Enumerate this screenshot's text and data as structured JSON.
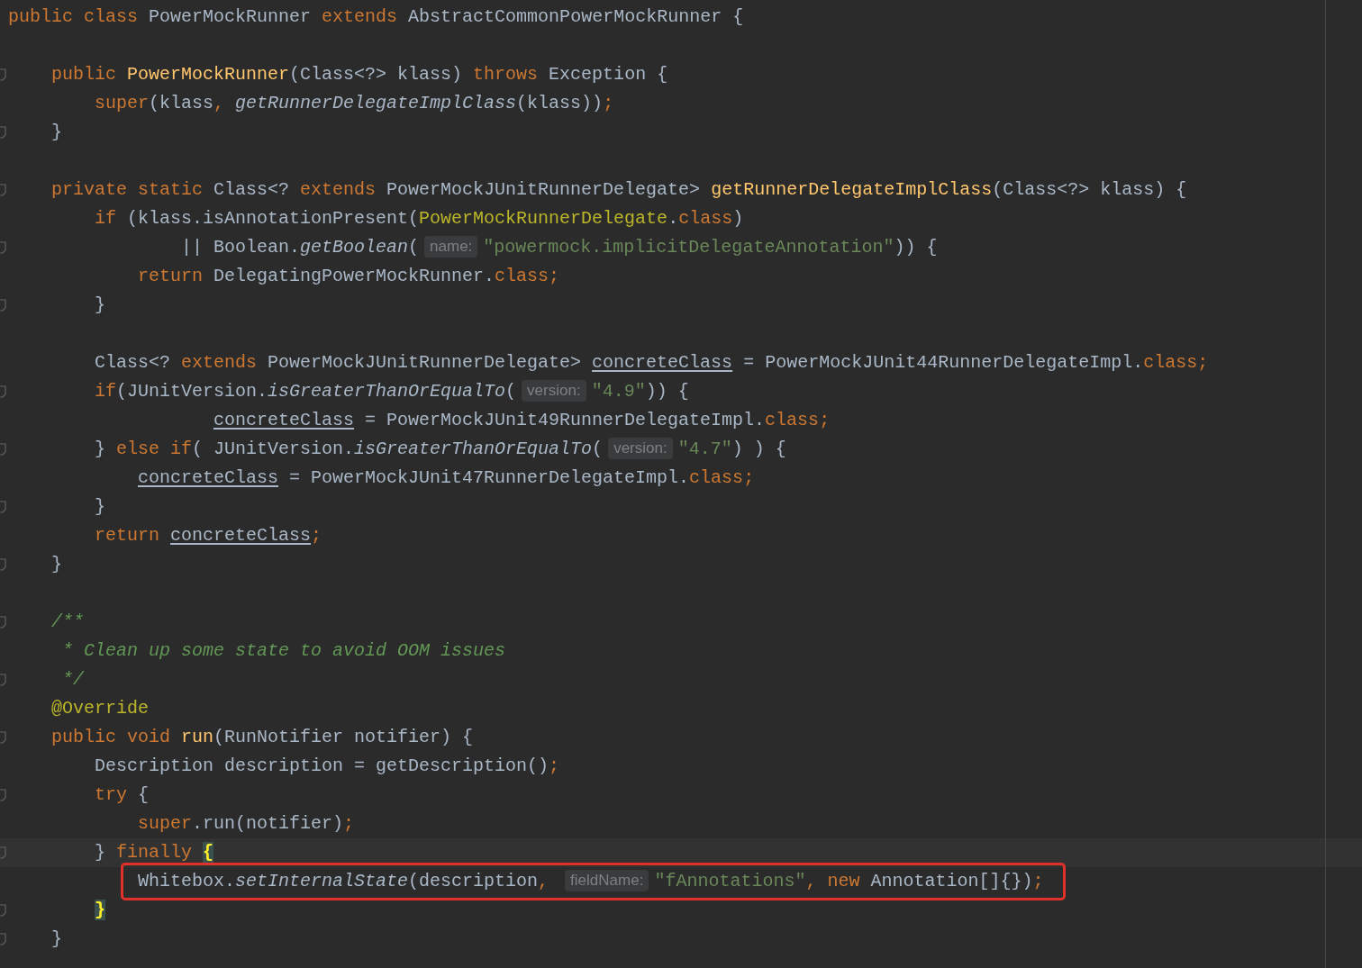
{
  "editor": {
    "lines": [
      {
        "kind": "code",
        "fold": false,
        "current": false,
        "boxed": false,
        "tokens": [
          {
            "kind": "kw",
            "text": "public class"
          },
          {
            "kind": "plain",
            "text": " PowerMockRunner "
          },
          {
            "kind": "kw",
            "text": "extends"
          },
          {
            "kind": "plain",
            "text": " AbstractCommonPowerMockRunner {"
          }
        ]
      },
      {
        "kind": "blank"
      },
      {
        "kind": "code",
        "fold": true,
        "current": false,
        "boxed": false,
        "tokens": [
          {
            "kind": "kw",
            "text": "    public "
          },
          {
            "kind": "decl",
            "text": "PowerMockRunner"
          },
          {
            "kind": "plain",
            "text": "(Class<?> klass) "
          },
          {
            "kind": "kw",
            "text": "throws"
          },
          {
            "kind": "plain",
            "text": " Exception {"
          }
        ]
      },
      {
        "kind": "code",
        "fold": false,
        "current": false,
        "boxed": false,
        "tokens": [
          {
            "kind": "kw",
            "text": "        super"
          },
          {
            "kind": "plain",
            "text": "(klass"
          },
          {
            "kind": "punct",
            "text": ", "
          },
          {
            "kind": "call",
            "text": "getRunnerDelegateImplClass"
          },
          {
            "kind": "plain",
            "text": "(klass))"
          },
          {
            "kind": "punct",
            "text": ";"
          }
        ]
      },
      {
        "kind": "code",
        "fold": true,
        "current": false,
        "boxed": false,
        "tokens": [
          {
            "kind": "plain",
            "text": "    }"
          }
        ]
      },
      {
        "kind": "blank"
      },
      {
        "kind": "code",
        "fold": true,
        "current": false,
        "boxed": false,
        "tokens": [
          {
            "kind": "kw",
            "text": "    private static "
          },
          {
            "kind": "plain",
            "text": "Class<? "
          },
          {
            "kind": "kw",
            "text": "extends"
          },
          {
            "kind": "plain",
            "text": " PowerMockJUnitRunnerDelegate> "
          },
          {
            "kind": "decl",
            "text": "getRunnerDelegateImplClass"
          },
          {
            "kind": "plain",
            "text": "(Class<?> klass) {"
          }
        ]
      },
      {
        "kind": "code",
        "fold": false,
        "current": false,
        "boxed": false,
        "tokens": [
          {
            "kind": "kw",
            "text": "        if"
          },
          {
            "kind": "plain",
            "text": " (klass.isAnnotationPresent("
          },
          {
            "kind": "annot",
            "text": "PowerMockRunnerDelegate"
          },
          {
            "kind": "plain",
            "text": "."
          },
          {
            "kind": "kw",
            "text": "class"
          },
          {
            "kind": "plain",
            "text": ")"
          }
        ]
      },
      {
        "kind": "code",
        "fold": true,
        "current": false,
        "boxed": false,
        "tokens": [
          {
            "kind": "plain",
            "text": "                || Boolean."
          },
          {
            "kind": "call",
            "text": "getBoolean"
          },
          {
            "kind": "plain",
            "text": "("
          },
          {
            "kind": "hint",
            "text": "name:"
          },
          {
            "kind": "str",
            "text": "\"powermock.implicitDelegateAnnotation\""
          },
          {
            "kind": "plain",
            "text": ")) {"
          }
        ]
      },
      {
        "kind": "code",
        "fold": false,
        "current": false,
        "boxed": false,
        "tokens": [
          {
            "kind": "kw",
            "text": "            return"
          },
          {
            "kind": "plain",
            "text": " DelegatingPowerMockRunner."
          },
          {
            "kind": "kw",
            "text": "class"
          },
          {
            "kind": "punct",
            "text": ";"
          }
        ]
      },
      {
        "kind": "code",
        "fold": true,
        "current": false,
        "boxed": false,
        "tokens": [
          {
            "kind": "plain",
            "text": "        }"
          }
        ]
      },
      {
        "kind": "blank"
      },
      {
        "kind": "code",
        "fold": false,
        "current": false,
        "boxed": false,
        "tokens": [
          {
            "kind": "plain",
            "text": "        Class<? "
          },
          {
            "kind": "kw",
            "text": "extends"
          },
          {
            "kind": "plain",
            "text": " PowerMockJUnitRunnerDelegate> "
          },
          {
            "kind": "field",
            "text": "concreteClass"
          },
          {
            "kind": "plain",
            "text": " = PowerMockJUnit44RunnerDelegateImpl."
          },
          {
            "kind": "kw",
            "text": "class"
          },
          {
            "kind": "punct",
            "text": ";"
          }
        ]
      },
      {
        "kind": "code",
        "fold": true,
        "current": false,
        "boxed": false,
        "tokens": [
          {
            "kind": "kw",
            "text": "        if"
          },
          {
            "kind": "plain",
            "text": "(JUnitVersion."
          },
          {
            "kind": "call",
            "text": "isGreaterThanOrEqualTo"
          },
          {
            "kind": "plain",
            "text": "("
          },
          {
            "kind": "hint",
            "text": "version:"
          },
          {
            "kind": "str",
            "text": "\"4.9\""
          },
          {
            "kind": "plain",
            "text": ")) {"
          }
        ]
      },
      {
        "kind": "code",
        "fold": false,
        "current": false,
        "boxed": false,
        "tokens": [
          {
            "kind": "field",
            "text": "                   concreteClass"
          },
          {
            "kind": "plain",
            "text": " = PowerMockJUnit49RunnerDelegateImpl."
          },
          {
            "kind": "kw",
            "text": "class"
          },
          {
            "kind": "punct",
            "text": ";"
          }
        ]
      },
      {
        "kind": "code",
        "fold": true,
        "current": false,
        "boxed": false,
        "tokens": [
          {
            "kind": "plain",
            "text": "        } "
          },
          {
            "kind": "kw",
            "text": "else if"
          },
          {
            "kind": "plain",
            "text": "( JUnitVersion."
          },
          {
            "kind": "call",
            "text": "isGreaterThanOrEqualTo"
          },
          {
            "kind": "plain",
            "text": "("
          },
          {
            "kind": "hint",
            "text": "version:"
          },
          {
            "kind": "str",
            "text": "\"4.7\""
          },
          {
            "kind": "plain",
            "text": ") ) {"
          }
        ]
      },
      {
        "kind": "code",
        "fold": false,
        "current": false,
        "boxed": false,
        "tokens": [
          {
            "kind": "field",
            "text": "            concreteClass"
          },
          {
            "kind": "plain",
            "text": " = PowerMockJUnit47RunnerDelegateImpl."
          },
          {
            "kind": "kw",
            "text": "class"
          },
          {
            "kind": "punct",
            "text": ";"
          }
        ]
      },
      {
        "kind": "code",
        "fold": true,
        "current": false,
        "boxed": false,
        "tokens": [
          {
            "kind": "plain",
            "text": "        }"
          }
        ]
      },
      {
        "kind": "code",
        "fold": false,
        "current": false,
        "boxed": false,
        "tokens": [
          {
            "kind": "kw",
            "text": "        return "
          },
          {
            "kind": "field",
            "text": "concreteClass"
          },
          {
            "kind": "punct",
            "text": ";"
          }
        ]
      },
      {
        "kind": "code",
        "fold": true,
        "current": false,
        "boxed": false,
        "tokens": [
          {
            "kind": "plain",
            "text": "    }"
          }
        ]
      },
      {
        "kind": "blank"
      },
      {
        "kind": "code",
        "fold": true,
        "current": false,
        "boxed": false,
        "tokens": [
          {
            "kind": "doc",
            "text": "    /**"
          }
        ]
      },
      {
        "kind": "code",
        "fold": false,
        "current": false,
        "boxed": false,
        "tokens": [
          {
            "kind": "doc",
            "text": "     * Clean up some state to avoid OOM issues"
          }
        ]
      },
      {
        "kind": "code",
        "fold": true,
        "current": false,
        "boxed": false,
        "tokens": [
          {
            "kind": "doc",
            "text": "     */"
          }
        ]
      },
      {
        "kind": "code",
        "fold": false,
        "current": false,
        "boxed": false,
        "tokens": [
          {
            "kind": "annot",
            "text": "    @Override"
          }
        ]
      },
      {
        "kind": "code",
        "fold": true,
        "current": false,
        "boxed": false,
        "tokens": [
          {
            "kind": "kw",
            "text": "    public void "
          },
          {
            "kind": "decl",
            "text": "run"
          },
          {
            "kind": "plain",
            "text": "(RunNotifier notifier) {"
          }
        ]
      },
      {
        "kind": "code",
        "fold": false,
        "current": false,
        "boxed": false,
        "tokens": [
          {
            "kind": "plain",
            "text": "        Description description = getDescription()"
          },
          {
            "kind": "punct",
            "text": ";"
          }
        ]
      },
      {
        "kind": "code",
        "fold": true,
        "current": false,
        "boxed": false,
        "tokens": [
          {
            "kind": "kw",
            "text": "        try"
          },
          {
            "kind": "plain",
            "text": " {"
          }
        ]
      },
      {
        "kind": "code",
        "fold": false,
        "current": false,
        "boxed": false,
        "tokens": [
          {
            "kind": "kw",
            "text": "            super"
          },
          {
            "kind": "plain",
            "text": ".run(notifier)"
          },
          {
            "kind": "punct",
            "text": ";"
          }
        ]
      },
      {
        "kind": "code",
        "fold": true,
        "current": true,
        "boxed": false,
        "tokens": [
          {
            "kind": "plain",
            "text": "        } "
          },
          {
            "kind": "kw",
            "text": "finally "
          },
          {
            "kind": "brace",
            "text": "{"
          }
        ]
      },
      {
        "kind": "code",
        "fold": false,
        "current": false,
        "boxed": true,
        "tokens": [
          {
            "kind": "plain",
            "text": "            Whitebox."
          },
          {
            "kind": "call",
            "text": "setInternalState"
          },
          {
            "kind": "plain",
            "text": "(description"
          },
          {
            "kind": "punct",
            "text": ", "
          },
          {
            "kind": "hint",
            "text": "fieldName:"
          },
          {
            "kind": "str",
            "text": "\"fAnnotations\""
          },
          {
            "kind": "punct",
            "text": ", "
          },
          {
            "kind": "kw",
            "text": "new"
          },
          {
            "kind": "plain",
            "text": " Annotation[]{})"
          },
          {
            "kind": "punct",
            "text": ";"
          }
        ]
      },
      {
        "kind": "code",
        "fold": true,
        "current": false,
        "boxed": false,
        "tokens": [
          {
            "kind": "brace",
            "text": "        }"
          }
        ]
      },
      {
        "kind": "code",
        "fold": true,
        "current": false,
        "boxed": false,
        "tokens": [
          {
            "kind": "plain",
            "text": "    }"
          }
        ]
      }
    ]
  }
}
